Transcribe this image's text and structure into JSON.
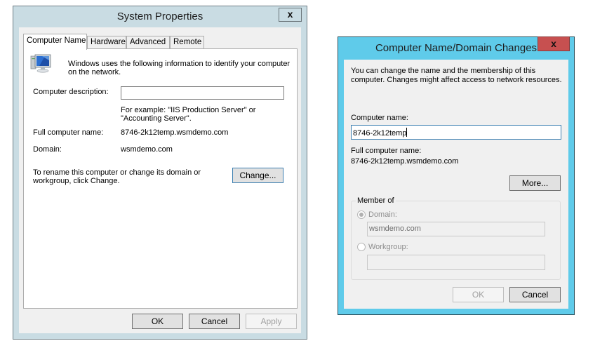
{
  "system_properties": {
    "title": "System Properties",
    "close_glyph": "x",
    "tabs": [
      {
        "label": "Computer Name",
        "active": true
      },
      {
        "label": "Hardware",
        "active": false
      },
      {
        "label": "Advanced",
        "active": false
      },
      {
        "label": "Remote",
        "active": false
      }
    ],
    "icon": "computer-icon",
    "intro_line1": "Windows uses the following information to identify your computer",
    "intro_line2": "on the network.",
    "description_label": "Computer description:",
    "description_value": "",
    "example_line1": "For example: \"IIS Production Server\" or",
    "example_line2": "\"Accounting Server\".",
    "full_name_label": "Full computer name:",
    "full_name_value": "8746-2k12temp.wsmdemo.com",
    "domain_label": "Domain:",
    "domain_value": "wsmdemo.com",
    "rename_line1": "To rename this computer or change its domain or",
    "rename_line2": "workgroup, click Change.",
    "change_button": "Change...",
    "ok_button": "OK",
    "cancel_button": "Cancel",
    "apply_button": "Apply"
  },
  "domain_changes": {
    "title": "Computer Name/Domain Changes",
    "close_glyph": "x",
    "intro_line1": "You can change the name and the membership of this",
    "intro_line2": "computer. Changes might affect access to network resources.",
    "computer_name_label": "Computer name:",
    "computer_name_value": "8746-2k12temp",
    "full_name_label": "Full computer name:",
    "full_name_value": "8746-2k12temp.wsmdemo.com",
    "more_button": "More...",
    "member_of_legend": "Member of",
    "domain_radio_label": "Domain:",
    "domain_value": "wsmdemo.com",
    "workgroup_radio_label": "Workgroup:",
    "workgroup_value": "",
    "selected_membership": "Domain",
    "ok_button": "OK",
    "cancel_button": "Cancel"
  }
}
